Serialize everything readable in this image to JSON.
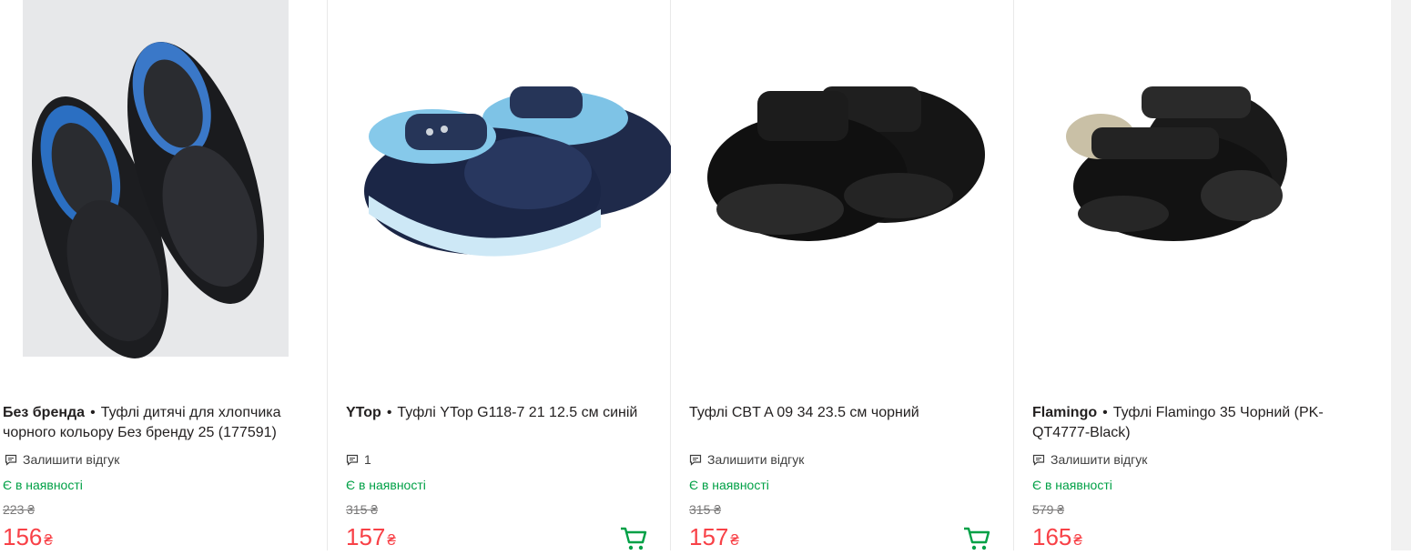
{
  "products": [
    {
      "brand": "Без бренда",
      "name": "Туфлі дитячі для хлопчика чорного кольору Без бренду 25 (177591)",
      "review": "Залишити відгук",
      "stock": "Є в наявності",
      "old_price": "223 ₴",
      "price": "156",
      "currency": "₴",
      "has_cart": false
    },
    {
      "brand": "YTop",
      "name": "Туфлі YTop G118-7 21 12.5 см синій",
      "review": "1",
      "stock": "Є в наявності",
      "old_price": "315 ₴",
      "price": "157",
      "currency": "₴",
      "has_cart": true
    },
    {
      "brand": "",
      "name": "Туфлі CBT A 09 34 23.5 см чорний",
      "review": "Залишити відгук",
      "stock": "Є в наявності",
      "old_price": "315 ₴",
      "price": "157",
      "currency": "₴",
      "has_cart": true
    },
    {
      "brand": "Flamingo",
      "name": "Туфлі Flamingo 35 Чорний (PK-QT4777-Black)",
      "review": "Залишити відгук",
      "stock": "Є в наявності",
      "old_price": "579 ₴",
      "price": "165",
      "currency": "₴",
      "has_cart": false
    }
  ],
  "colors": {
    "price": "#f84147",
    "stock": "#00a046",
    "cart": "#00a046"
  },
  "icons": {
    "review": "comment-icon",
    "cart": "cart-icon"
  }
}
